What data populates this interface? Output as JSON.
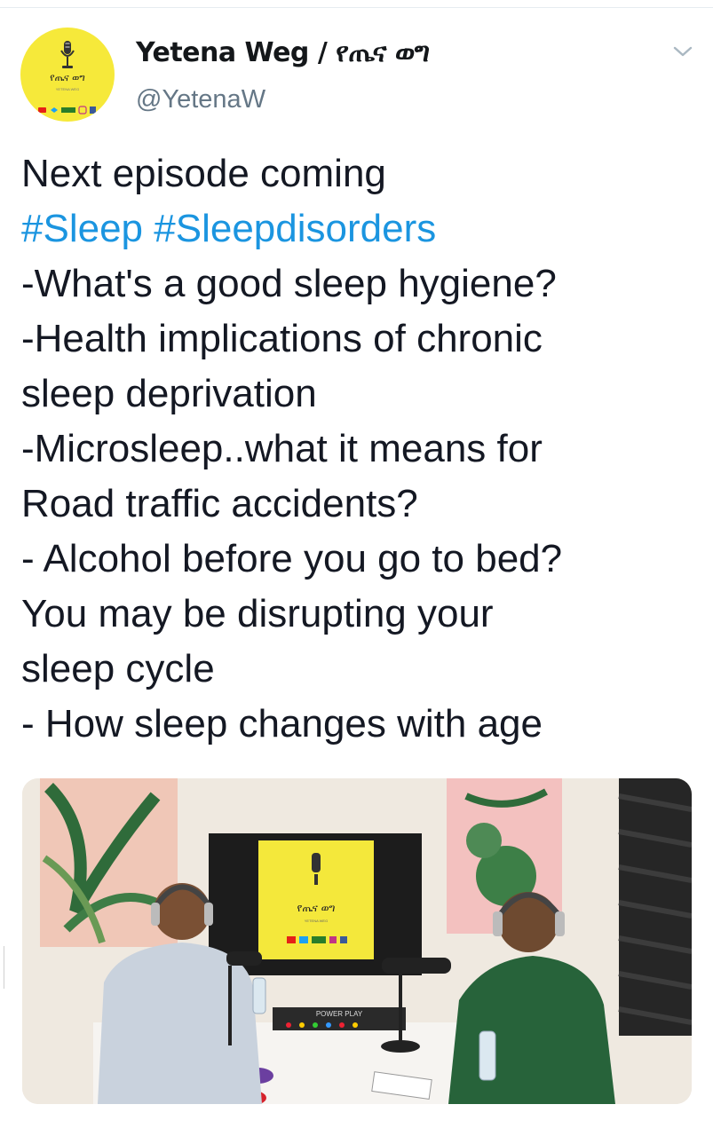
{
  "account": {
    "display_name": "Yetena Weg / የጤና ወግ",
    "handle": "@YetenaW",
    "avatar_text": "የጤና ወግ",
    "avatar_subtext": "YETENA WEG"
  },
  "tweet": {
    "lines": [
      [
        {
          "text": "Next episode coming",
          "type": "text"
        }
      ],
      [
        {
          "text": "#Sleep",
          "type": "hashtag"
        },
        {
          "text": " ",
          "type": "text"
        },
        {
          "text": "#Sleepdisorders",
          "type": "hashtag"
        }
      ],
      [
        {
          "text": "-What's a good sleep hygiene?",
          "type": "text"
        }
      ],
      [
        {
          "text": "-Health implications of chronic",
          "type": "text"
        }
      ],
      [
        {
          "text": "sleep deprivation",
          "type": "text"
        }
      ],
      [
        {
          "text": "-Microsleep..what it means for",
          "type": "text"
        }
      ],
      [
        {
          "text": "Road traffic accidents?",
          "type": "text"
        }
      ],
      [
        {
          "text": "- Alcohol before you go to bed?",
          "type": "text"
        }
      ],
      [
        {
          "text": "You may be disrupting your",
          "type": "text"
        }
      ],
      [
        {
          "text": "sleep cycle",
          "type": "text"
        }
      ],
      [
        {
          "text": "- How sleep changes with age",
          "type": "text"
        }
      ]
    ]
  },
  "media": {
    "screen_logo_text": "የጤና ወግ",
    "screen_subtext": "YETENA WEG",
    "mixer_label": "POWER PLAY"
  },
  "icons": {
    "menu": "chevron-down-icon",
    "mic": "microphone-icon"
  },
  "colors": {
    "hashtag": "#1b95e0",
    "handle": "#657786",
    "brand_yellow": "#f6e93a"
  }
}
